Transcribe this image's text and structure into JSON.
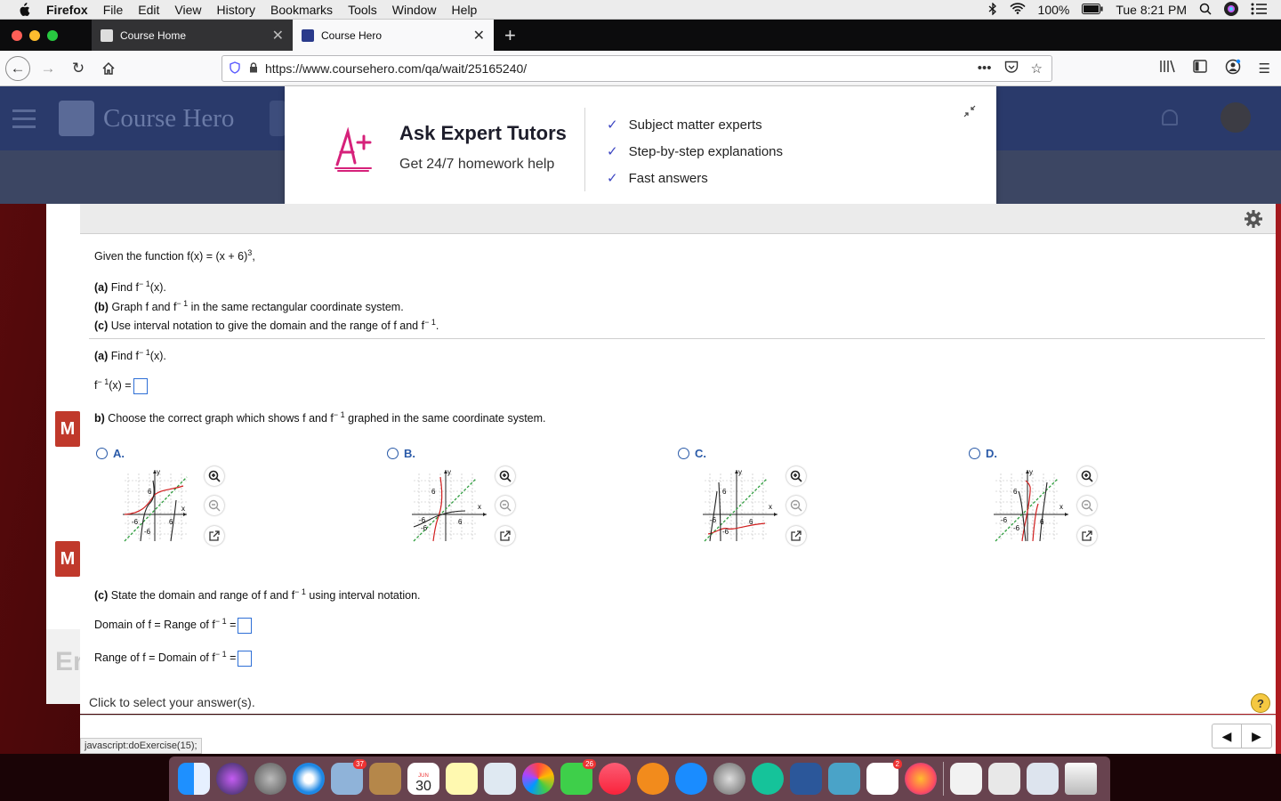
{
  "menubar": {
    "app": "Firefox",
    "items": [
      "File",
      "Edit",
      "View",
      "History",
      "Bookmarks",
      "Tools",
      "Window",
      "Help"
    ],
    "battery": "100%",
    "clock": "Tue 8:21 PM"
  },
  "tabs": [
    {
      "label": "Course Home",
      "active": false
    },
    {
      "label": "Course Hero",
      "active": true
    }
  ],
  "url": "https://www.coursehero.com/qa/wait/25165240/",
  "coursehero": {
    "logo_text": "Course Hero"
  },
  "popup": {
    "title": "Ask Expert Tutors",
    "subtitle": "Get 24/7 homework help",
    "features": [
      "Subject matter experts",
      "Step-by-step explanations",
      "Fast answers"
    ]
  },
  "question": {
    "given_prefix": "Given the function f(x) = (x + 6)",
    "given_exp": "3",
    "given_suffix": ",",
    "part_a_label": "(a)",
    "part_a_text": "Find f",
    "inv_exp": "− 1",
    "part_a_tail": "(x).",
    "part_b_label": "(b)",
    "part_b_text": "Graph f and f",
    "part_b_tail": "in the same rectangular coordinate system.",
    "part_c_label": "(c)",
    "part_c_text": "Use interval notation to give the domain and the range of f and f",
    "part_c_tail": "."
  },
  "answer": {
    "a_label": "(a)",
    "a_text": "Find f",
    "a_tail": "(x).",
    "a_input_prefix": "f",
    "a_input_suffix": "(x) =",
    "b_prompt_label": "b)",
    "b_prompt": "Choose the correct graph which shows f and f",
    "b_prompt_tail": "graphed in the same coordinate system.",
    "options": [
      "A.",
      "B.",
      "C.",
      "D."
    ],
    "graph_labels": {
      "y": "y",
      "x": "x",
      "pos": "6",
      "neg": "-6"
    },
    "c_label": "(c)",
    "c_prompt": "State the domain and range of f and f",
    "c_prompt_tail": "using interval notation.",
    "domain_label": "Domain of f = Range of f",
    "range_label": "Range of f = Domain of f",
    "eq": "="
  },
  "footer": {
    "click_text": "Click to select your answer(s).",
    "help": "?",
    "status_url": "javascript:doExercise(15);"
  },
  "dock": {
    "badges": [
      "37",
      "26",
      "2"
    ],
    "calendar": {
      "month": "JUN",
      "day": "30"
    }
  },
  "colors": {
    "accent_blue": "#2a5aa8",
    "inverse_curve": "#d11f1f",
    "identity_line": "#2e9e3e",
    "function_curve": "#222222",
    "coursehero_navy": "#2a3a6b"
  }
}
